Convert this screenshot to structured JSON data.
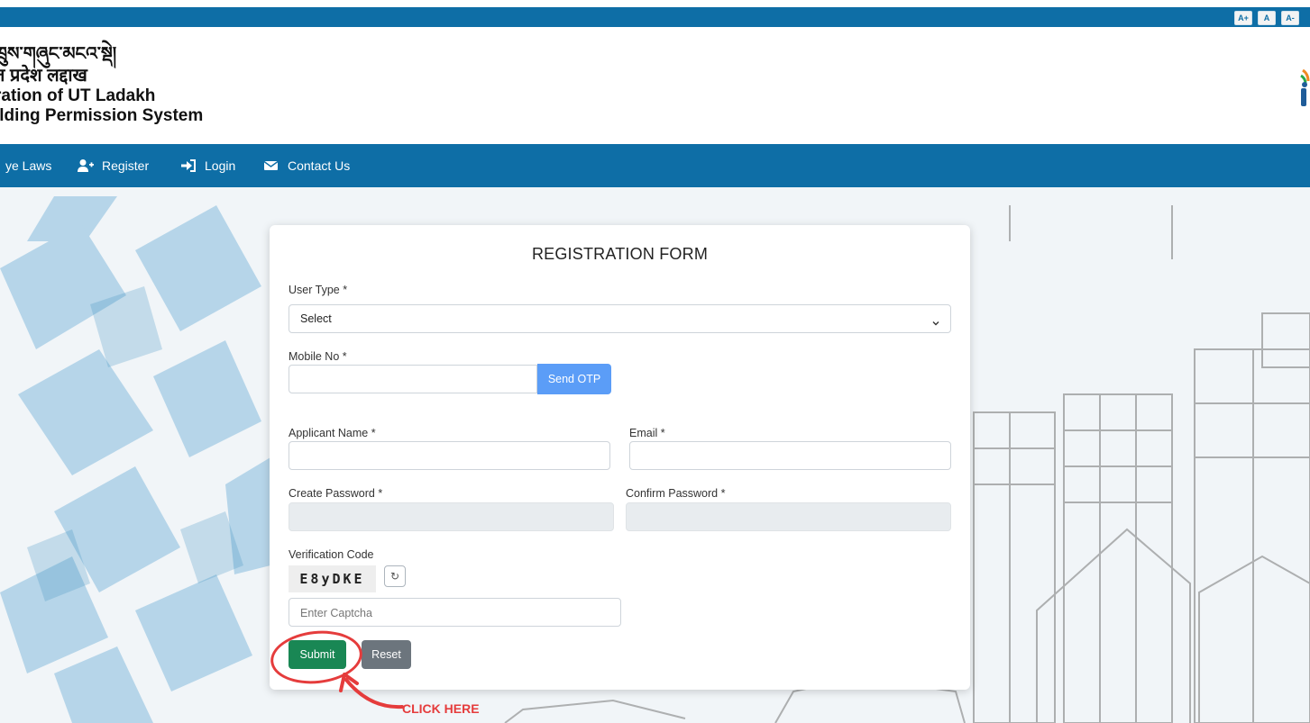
{
  "top_bar": {
    "font_buttons": [
      "A+",
      "A",
      "A-"
    ]
  },
  "header": {
    "line1": "ཁྲུས་གཞུང་མངའ་སྡེ།",
    "line2": "त प्रदेश लद्दाख",
    "line3": "ration of UT Ladakh",
    "line4": "ilding Permission System"
  },
  "nav": {
    "items": [
      {
        "label": "ye Laws",
        "icon": "none"
      },
      {
        "label": "Register",
        "icon": "user-plus-icon"
      },
      {
        "label": "Login",
        "icon": "sign-in-icon"
      },
      {
        "label": "Contact Us",
        "icon": "envelope-icon"
      }
    ]
  },
  "form": {
    "title": "REGISTRATION FORM",
    "user_type_label": "User Type *",
    "user_type_value": "Select",
    "mobile_label": "Mobile No *",
    "mobile_value": "",
    "send_otp": "Send OTP",
    "applicant_label": "Applicant Name *",
    "applicant_value": "",
    "email_label": "Email *",
    "email_value": "",
    "create_password_label": "Create Password *",
    "confirm_password_label": "Confirm Password *",
    "verification_label": "Verification Code",
    "captcha_code": "E8yDKE",
    "refresh_glyph": "↻",
    "captcha_placeholder": "Enter Captcha",
    "submit": "Submit",
    "reset": "Reset"
  },
  "annotation": {
    "text": "CLICK HERE",
    "color": "#e53c3c"
  },
  "colors": {
    "brand_blue": "#0e6ea6",
    "submit_green": "#198754",
    "reset_gray": "#6c757d",
    "otp_blue": "#5b9df7"
  }
}
